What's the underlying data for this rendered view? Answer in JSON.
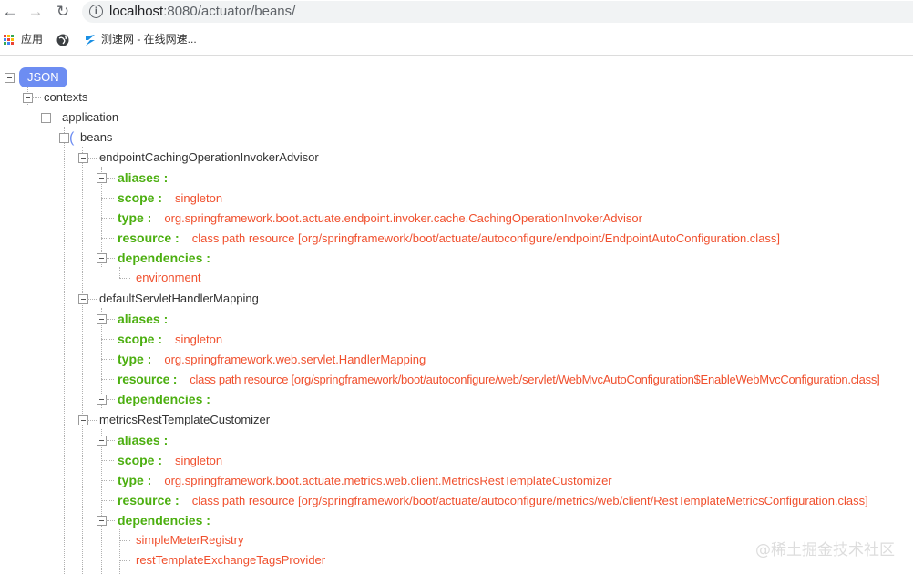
{
  "browser": {
    "back_icon": "←",
    "forward_icon": "→",
    "reload_icon": "↻",
    "info_icon": "i",
    "url_host": "localhost",
    "url_path": ":8080/actuator/beans/",
    "bookmarks": [
      {
        "label": "应用"
      },
      {
        "label": ""
      },
      {
        "label": "测速网 - 在线网速..."
      }
    ]
  },
  "tree": {
    "root_label": "JSON",
    "contexts_label": "contexts",
    "application_label": "application",
    "beans_label": "beans",
    "brace": "(",
    "bean1": {
      "name": "endpointCachingOperationInvokerAdvisor",
      "aliases_key": "aliases :",
      "scope_key": "scope :",
      "scope_val": "singleton",
      "type_key": "type :",
      "type_val": "org.springframework.boot.actuate.endpoint.invoker.cache.CachingOperationInvokerAdvisor",
      "resource_key": "resource :",
      "resource_val": "class path resource [org/springframework/boot/actuate/autoconfigure/endpoint/EndpointAutoConfiguration.class]",
      "dependencies_key": "dependencies :",
      "dependencies": [
        "environment"
      ]
    },
    "bean2": {
      "name": "defaultServletHandlerMapping",
      "aliases_key": "aliases :",
      "scope_key": "scope :",
      "scope_val": "singleton",
      "type_key": "type :",
      "type_val": "org.springframework.web.servlet.HandlerMapping",
      "resource_key": "resource :",
      "resource_val": "class path resource [org/springframework/boot/autoconfigure/web/servlet/WebMvcAutoConfiguration$EnableWebMvcConfiguration.class]",
      "dependencies_key": "dependencies :"
    },
    "bean3": {
      "name": "metricsRestTemplateCustomizer",
      "aliases_key": "aliases :",
      "scope_key": "scope :",
      "scope_val": "singleton",
      "type_key": "type :",
      "type_val": "org.springframework.boot.actuate.metrics.web.client.MetricsRestTemplateCustomizer",
      "resource_key": "resource :",
      "resource_val": "class path resource [org/springframework/boot/actuate/autoconfigure/metrics/web/client/RestTemplateMetricsConfiguration.class]",
      "dependencies_key": "dependencies :",
      "dependencies": [
        "simpleMeterRegistry",
        "restTemplateExchangeTagsProvider"
      ]
    }
  },
  "watermark": "@稀土掘金技术社区",
  "colors": {
    "key": "#4caf10",
    "value": "#f0502e",
    "badge": "#6d8df2"
  }
}
